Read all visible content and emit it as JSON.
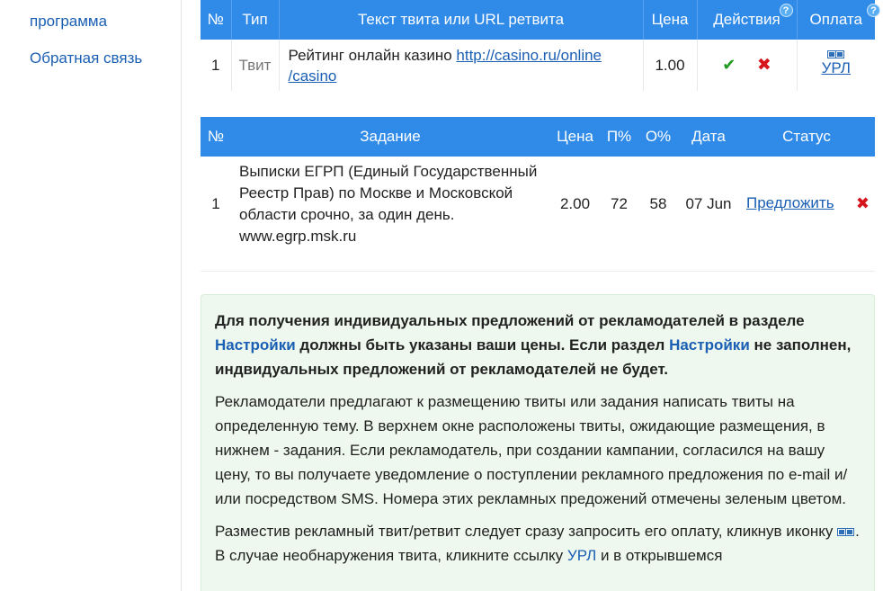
{
  "sidebar": {
    "items": [
      {
        "label": "программа"
      },
      {
        "label": "Обратная связь"
      }
    ]
  },
  "tweets_table": {
    "headers": {
      "num": "№",
      "type": "Тип",
      "text": "Текст твита или URL ретвита",
      "price": "Цена",
      "actions": "Действия",
      "payment": "Оплата"
    },
    "help_glyph": "?",
    "rows": [
      {
        "num": "1",
        "type": "Твит",
        "text_prefix": "Рейтинг онлайн казино ",
        "url_line1": "http://casino.ru/online",
        "url_line2": "/casino",
        "price": "1.00",
        "accept_glyph": "✔",
        "reject_glyph": "✖",
        "payment_link": "УРЛ"
      }
    ]
  },
  "tasks_table": {
    "headers": {
      "num": "№",
      "task": "Задание",
      "price": "Цена",
      "p_percent": "П%",
      "o_percent": "О%",
      "date": "Дата",
      "status": "Статус"
    },
    "rows": [
      {
        "num": "1",
        "task": "Выписки ЕГРП (Единый Государственный Реестр Прав) по Москве и Московской области срочно, за один день. www.egrp.msk.ru",
        "price": "2.00",
        "p_percent": "72",
        "o_percent": "58",
        "date": "07 Jun",
        "status_link": "Предложить",
        "reject_glyph": "✖"
      }
    ]
  },
  "info": {
    "p1_a": "Для получения индивидуальных предложений от рекламодателей в разделе ",
    "p1_link1": "Настройки",
    "p1_b": " должны быть указаны ваши цены. Если раздел ",
    "p1_link2": "Настройки",
    "p1_c": " не заполнен, индвидуальных предложений от рекламодателей не будет.",
    "p2": "Рекламодатели предлагают к размещению твиты или задания написать твиты на определенную тему. В верхнем окне расположены твиты, ожидающие размещения, в нижнем - задания. Если рекламодатель, при создании кампании, согласился на вашу цену, то вы получаете уведомление о поступлении рекламного предложения по e-mail и/или посредством SMS. Номера этих рекламных предожений отмечены зеленым цветом.",
    "p3_a": "Разместив рекламный твит/ретвит следует сразу запросить его оплату, кликнув иконку ",
    "p3_b": ". В случае необнаружения твита, кликните ссылку ",
    "p3_link": "УРЛ",
    "p3_c": " и в открывшемся"
  },
  "colors": {
    "header_blue": "#2f8ae8",
    "link_blue": "#1a5fb4",
    "accept_green": "#1f9a1f",
    "reject_red": "#d6141c",
    "info_bg": "#eef8ee"
  }
}
